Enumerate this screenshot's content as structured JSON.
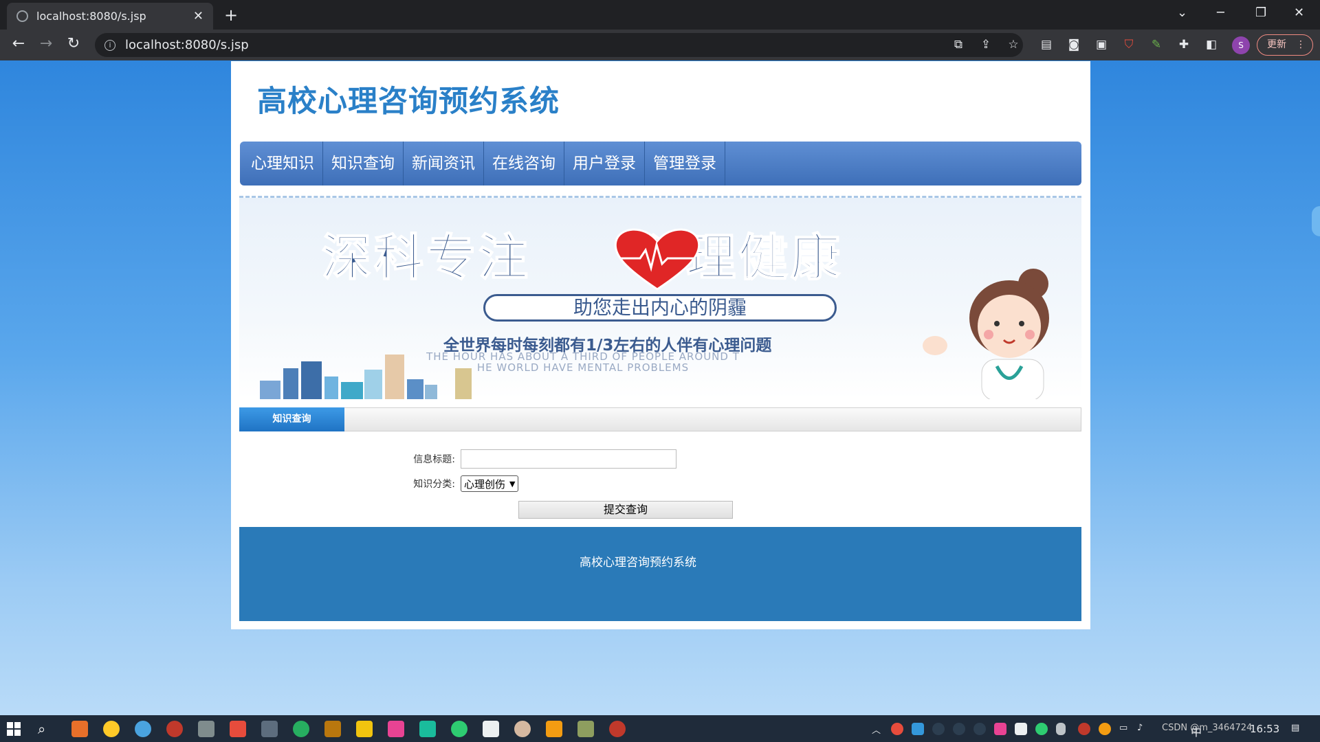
{
  "browser": {
    "tab_title": "localhost:8080/s.jsp",
    "url": "localhost:8080/s.jsp",
    "update_label": "更新",
    "profile_initial": "S"
  },
  "site": {
    "title": "高校心理咨询预约系统",
    "nav": [
      "心理知识",
      "知识查询",
      "新闻资讯",
      "在线咨询",
      "用户登录",
      "管理登录"
    ]
  },
  "banner": {
    "headline_left": "深科专注",
    "headline_right": "心理健康",
    "pill": "助您走出内心的阴霾",
    "subline": "全世界每时每刻都有1/3左右的人伴有心理问题",
    "english_line1": "THE HOUR HAS ABOUT A THIRD OF PEOPLE AROUND T",
    "english_line2": "HE WORLD HAVE MENTAL PROBLEMS"
  },
  "search": {
    "section_tab": "知识查询",
    "title_label": "信息标题:",
    "title_value": "",
    "category_label": "知识分类:",
    "category_selected": "心理创伤",
    "submit_label": "提交查询"
  },
  "footer": {
    "text": "高校心理咨询预约系统"
  },
  "taskbar": {
    "tray_text": "CSDN @m_3464724",
    "clock": "16:53",
    "ime": "中"
  }
}
